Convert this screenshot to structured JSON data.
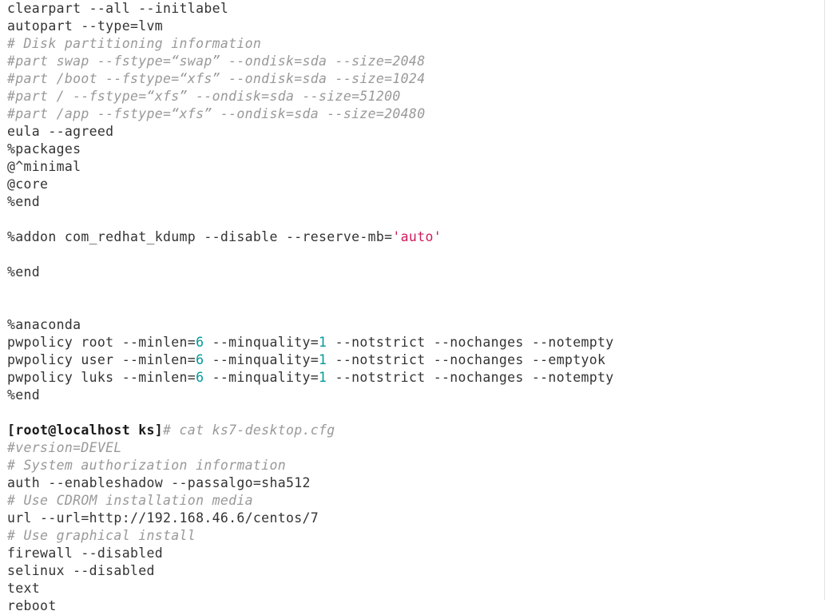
{
  "terminal": {
    "background_color": "#ffffff",
    "default_text_color": "#333333",
    "comment_color": "#999999",
    "number_color": "#009999",
    "string_color": "#d01a5a",
    "prompt_color": "#1a1a1a",
    "border_color": "#e3e3e3"
  },
  "lines": [
    {
      "id": "l1",
      "tokens": [
        {
          "t": "plain",
          "v": "clearpart --all --initlabel"
        }
      ]
    },
    {
      "id": "l2",
      "tokens": [
        {
          "t": "plain",
          "v": "autopart --type=lvm"
        }
      ]
    },
    {
      "id": "l3",
      "tokens": [
        {
          "t": "comment",
          "v": "# Disk partitioning information"
        }
      ]
    },
    {
      "id": "l4",
      "tokens": [
        {
          "t": "comment",
          "v": "#part swap --fstype=“swap” --ondisk=sda --size=2048"
        }
      ]
    },
    {
      "id": "l5",
      "tokens": [
        {
          "t": "comment",
          "v": "#part /boot --fstype=“xfs” --ondisk=sda --size=1024"
        }
      ]
    },
    {
      "id": "l6",
      "tokens": [
        {
          "t": "comment",
          "v": "#part / --fstype=“xfs” --ondisk=sda --size=51200"
        }
      ]
    },
    {
      "id": "l7",
      "tokens": [
        {
          "t": "comment",
          "v": "#part /app --fstype=“xfs” --ondisk=sda --size=20480"
        }
      ]
    },
    {
      "id": "l8",
      "tokens": [
        {
          "t": "plain",
          "v": "eula --agreed"
        }
      ]
    },
    {
      "id": "l9",
      "tokens": [
        {
          "t": "plain",
          "v": "%packages"
        }
      ]
    },
    {
      "id": "l10",
      "tokens": [
        {
          "t": "plain",
          "v": "@^minimal"
        }
      ]
    },
    {
      "id": "l11",
      "tokens": [
        {
          "t": "plain",
          "v": "@core"
        }
      ]
    },
    {
      "id": "l12",
      "tokens": [
        {
          "t": "plain",
          "v": "%end"
        }
      ]
    },
    {
      "id": "l13",
      "tokens": []
    },
    {
      "id": "l14",
      "tokens": [
        {
          "t": "plain",
          "v": "%addon com_redhat_kdump --disable --reserve-mb="
        },
        {
          "t": "string",
          "v": "'auto'"
        }
      ]
    },
    {
      "id": "l15",
      "tokens": []
    },
    {
      "id": "l16",
      "tokens": [
        {
          "t": "plain",
          "v": "%end"
        }
      ]
    },
    {
      "id": "l17",
      "tokens": []
    },
    {
      "id": "l18",
      "tokens": []
    },
    {
      "id": "l19",
      "tokens": [
        {
          "t": "plain",
          "v": "%anaconda"
        }
      ]
    },
    {
      "id": "l20",
      "tokens": [
        {
          "t": "plain",
          "v": "pwpolicy root --minlen="
        },
        {
          "t": "number",
          "v": "6"
        },
        {
          "t": "plain",
          "v": " --minquality="
        },
        {
          "t": "number",
          "v": "1"
        },
        {
          "t": "plain",
          "v": " --notstrict --nochanges --notempty"
        }
      ]
    },
    {
      "id": "l21",
      "tokens": [
        {
          "t": "plain",
          "v": "pwpolicy user --minlen="
        },
        {
          "t": "number",
          "v": "6"
        },
        {
          "t": "plain",
          "v": " --minquality="
        },
        {
          "t": "number",
          "v": "1"
        },
        {
          "t": "plain",
          "v": " --notstrict --nochanges --emptyok"
        }
      ]
    },
    {
      "id": "l22",
      "tokens": [
        {
          "t": "plain",
          "v": "pwpolicy luks --minlen="
        },
        {
          "t": "number",
          "v": "6"
        },
        {
          "t": "plain",
          "v": " --minquality="
        },
        {
          "t": "number",
          "v": "1"
        },
        {
          "t": "plain",
          "v": " --notstrict --nochanges --notempty"
        }
      ]
    },
    {
      "id": "l23",
      "tokens": [
        {
          "t": "plain",
          "v": "%end"
        }
      ]
    },
    {
      "id": "l24",
      "tokens": []
    },
    {
      "id": "l25",
      "tokens": [
        {
          "t": "prompt",
          "v": "[root@localhost ks]"
        },
        {
          "t": "command",
          "v": "# cat ks7-desktop.cfg"
        }
      ]
    },
    {
      "id": "l26",
      "tokens": [
        {
          "t": "comment",
          "v": "#version=DEVEL"
        }
      ]
    },
    {
      "id": "l27",
      "tokens": [
        {
          "t": "comment",
          "v": "# System authorization information"
        }
      ]
    },
    {
      "id": "l28",
      "tokens": [
        {
          "t": "plain",
          "v": "auth --enableshadow --passalgo=sha512"
        }
      ]
    },
    {
      "id": "l29",
      "tokens": [
        {
          "t": "comment",
          "v": "# Use CDROM installation media"
        }
      ]
    },
    {
      "id": "l30",
      "tokens": [
        {
          "t": "plain",
          "v": "url --url=http://192.168.46.6/centos/7"
        }
      ]
    },
    {
      "id": "l31",
      "tokens": [
        {
          "t": "comment",
          "v": "# Use graphical install"
        }
      ]
    },
    {
      "id": "l32",
      "tokens": [
        {
          "t": "plain",
          "v": "firewall --disabled"
        }
      ]
    },
    {
      "id": "l33",
      "tokens": [
        {
          "t": "plain",
          "v": "selinux --disabled"
        }
      ]
    },
    {
      "id": "l34",
      "tokens": [
        {
          "t": "plain",
          "v": "text"
        }
      ]
    },
    {
      "id": "l35",
      "tokens": [
        {
          "t": "plain",
          "v": "reboot"
        }
      ]
    }
  ]
}
